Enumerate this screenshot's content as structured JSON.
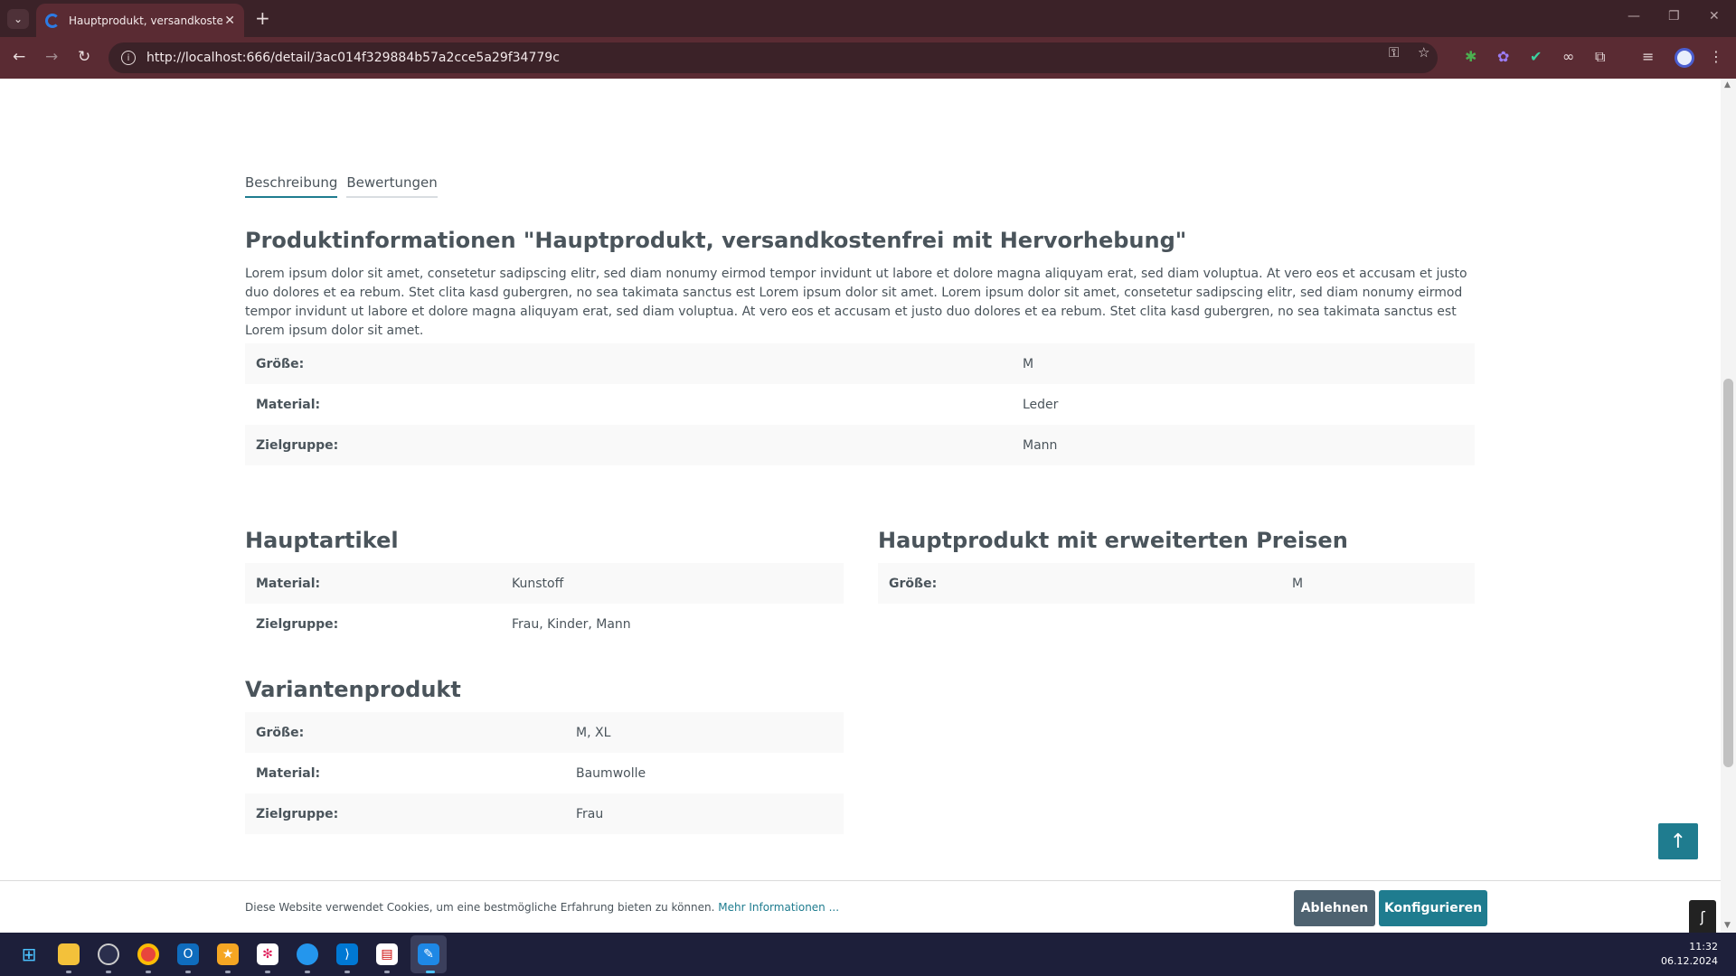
{
  "browser": {
    "tab_title": "Hauptprodukt, versandkostenfrei mit Hervorhebung",
    "url": "http://localhost:666/detail/3ac014f329884b57a2cce5a29f34779c"
  },
  "tabs": [
    {
      "label": "Beschreibung",
      "active": true
    },
    {
      "label": "Bewertungen",
      "active": false
    }
  ],
  "product_info": {
    "heading": "Produktinformationen \"Hauptprodukt, versandkostenfrei mit Hervorhebung\"",
    "description": "Lorem ipsum dolor sit amet, consetetur sadipscing elitr, sed diam nonumy eirmod tempor invidunt ut labore et dolore magna aliquyam erat, sed diam voluptua. At vero eos et accusam et justo duo dolores et ea rebum. Stet clita kasd gubergren, no sea takimata sanctus est Lorem ipsum dolor sit amet. Lorem ipsum dolor sit amet, consetetur sadipscing elitr, sed diam nonumy eirmod tempor invidunt ut labore et dolore magna aliquyam erat, sed diam voluptua. At vero eos et accusam et justo duo dolores et ea rebum. Stet clita kasd gubergren, no sea takimata sanctus est Lorem ipsum dolor sit amet.",
    "properties": [
      {
        "key": "Größe:",
        "value": "M"
      },
      {
        "key": "Material:",
        "value": "Leder"
      },
      {
        "key": "Zielgruppe:",
        "value": "Mann"
      }
    ]
  },
  "hauptartikel": {
    "heading": "Hauptartikel",
    "properties": [
      {
        "key": "Material:",
        "value": "Kunstoff"
      },
      {
        "key": "Zielgruppe:",
        "value": "Frau, Kinder, Mann"
      }
    ]
  },
  "erweiterte_preise": {
    "heading": "Hauptprodukt mit erweiterten Preisen",
    "properties": [
      {
        "key": "Größe:",
        "value": "M"
      }
    ]
  },
  "variantenprodukt": {
    "heading": "Variantenprodukt",
    "properties": [
      {
        "key": "Größe:",
        "value": "M, XL"
      },
      {
        "key": "Material:",
        "value": "Baumwolle"
      },
      {
        "key": "Zielgruppe:",
        "value": "Frau"
      }
    ]
  },
  "cookie": {
    "text": "Diese Website verwendet Cookies, um eine bestmögliche Erfahrung bieten zu können.",
    "more_link": "Mehr Informationen ...",
    "decline": "Ablehnen",
    "configure": "Konfigurieren"
  },
  "taskbar": {
    "time": "11:32",
    "date": "06.12.2024"
  },
  "colors": {
    "accent": "#1f7c8f",
    "decline_button": "#4e6270",
    "chrome_frame": "#5a2b33"
  }
}
